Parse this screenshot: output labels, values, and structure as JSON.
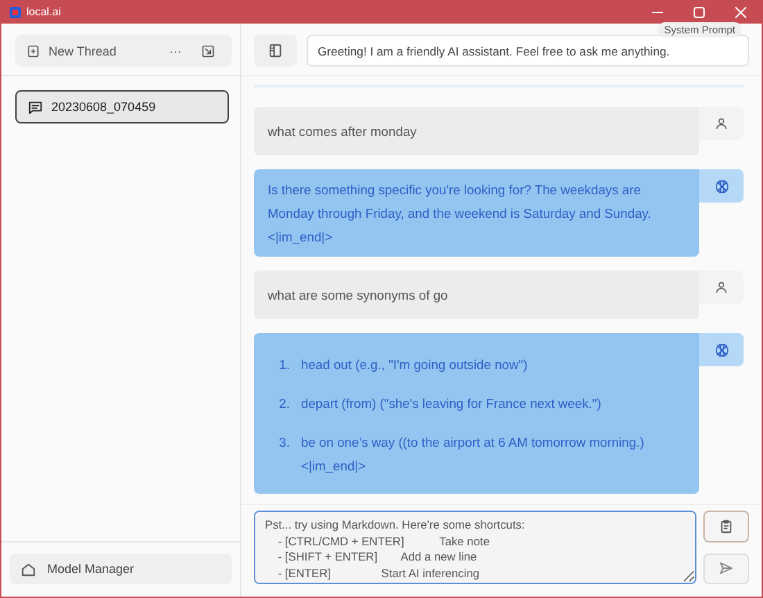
{
  "window": {
    "title": "local.ai"
  },
  "sidebar": {
    "new_thread": "New Thread",
    "more": "···",
    "threads": [
      {
        "label": "20230608_070459",
        "selected": true
      }
    ],
    "model_manager": "Model Manager"
  },
  "system_prompt": {
    "label": "System Prompt",
    "value": "Greeting! I am a friendly AI assistant. Feel free to ask me anything."
  },
  "messages": [
    {
      "kind": "user",
      "text": "what comes after monday"
    },
    {
      "kind": "bot",
      "text": "Is there something specific you're looking for? The weekdays are Monday through Friday, and the weekend is Saturday and Sunday.",
      "tail": "<|im_end|>"
    },
    {
      "kind": "user",
      "text": "what are some synonyms of go"
    },
    {
      "kind": "bot_list",
      "items": [
        {
          "marker": "1.",
          "text": "head out (e.g., \"I'm going outside now\")"
        },
        {
          "marker": "2.",
          "text": "depart (from) (\"she's leaving for France next week.\")"
        },
        {
          "marker": "3.",
          "text": "be on one’s way ((to the airport at 6 AM tomorrow morning.)"
        }
      ],
      "tail": "<|im_end|>"
    }
  ],
  "composer": {
    "placeholder": "Pst... try using Markdown. Here're some shortcuts:\n    - [CTRL/CMD + ENTER]\t\tTake note\n    - [SHIFT + ENTER]\t\tAdd a new line\n    - [ENTER]\t\t\tStart AI inferencing"
  }
}
